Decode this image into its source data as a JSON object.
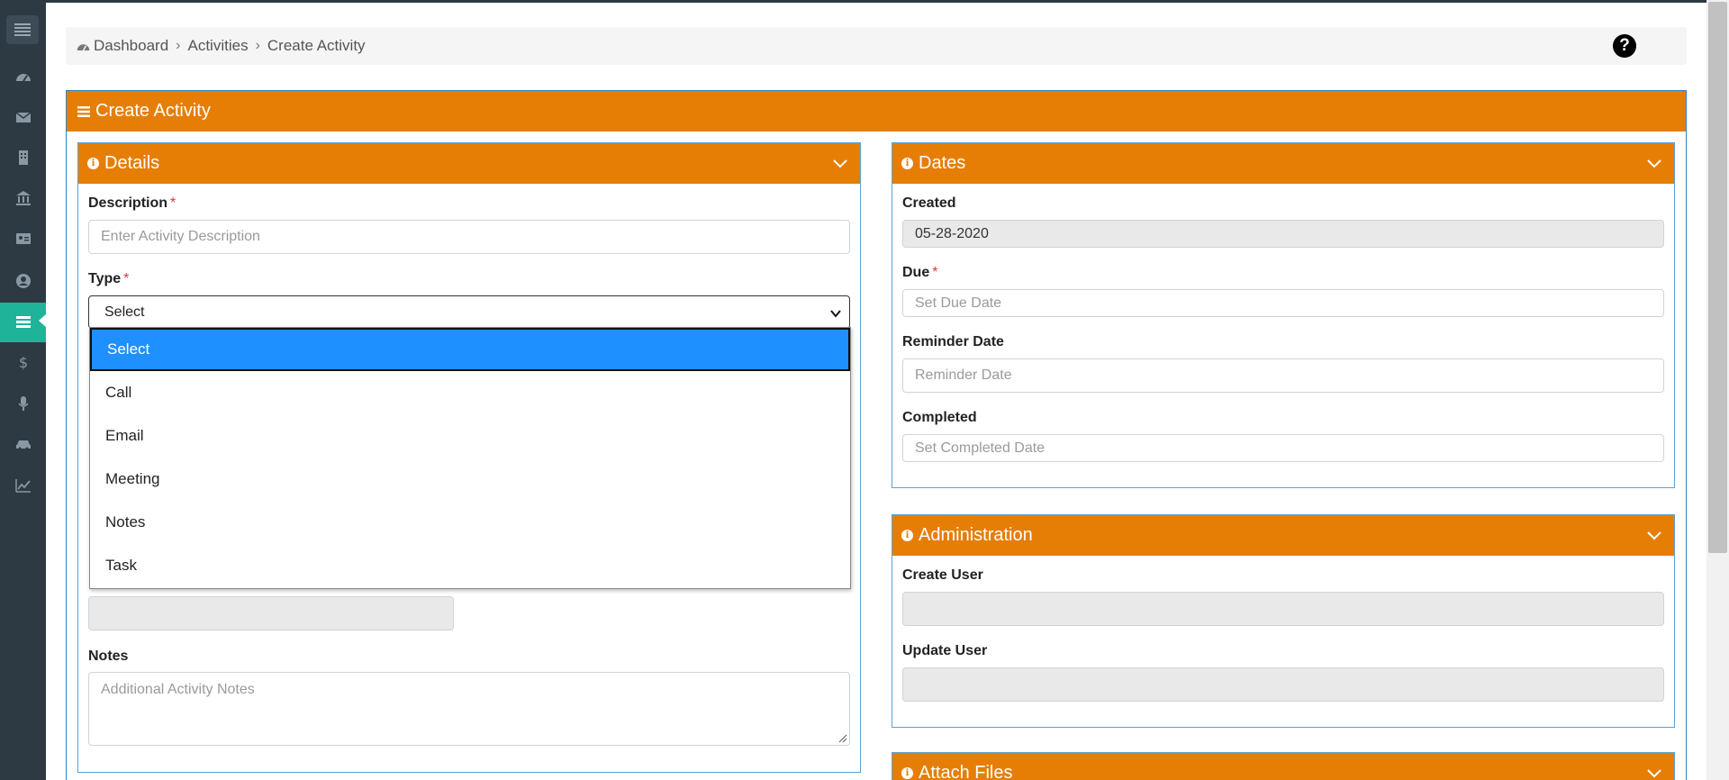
{
  "breadcrumb": {
    "items": [
      "Dashboard",
      "Activities",
      "Create Activity"
    ]
  },
  "main": {
    "title": "Create Activity"
  },
  "details": {
    "title": "Details",
    "description_label": "Description",
    "description_placeholder": "Enter Activity Description",
    "type_label": "Type",
    "type_value": "Select",
    "type_options": [
      "Select",
      "Call",
      "Email",
      "Meeting",
      "Notes",
      "Task"
    ],
    "notes_label": "Notes",
    "notes_placeholder": "Additional Activity Notes"
  },
  "dates": {
    "title": "Dates",
    "created_label": "Created",
    "created_value": "05-28-2020",
    "due_label": "Due",
    "due_placeholder": "Set Due Date",
    "reminder_label": "Reminder Date",
    "reminder_placeholder": "Reminder Date",
    "completed_label": "Completed",
    "completed_placeholder": "Set Completed Date"
  },
  "administration": {
    "title": "Administration",
    "create_user_label": "Create User",
    "create_user_value": "",
    "update_user_label": "Update User",
    "update_user_value": ""
  },
  "attach": {
    "title": "Attach Files"
  },
  "sidebar": {
    "icons": [
      "menu-icon",
      "dashboard-icon",
      "envelope-icon",
      "building-icon",
      "bank-icon",
      "id-card-icon",
      "user-circle-icon",
      "activities-icon",
      "dollar-icon",
      "microphone-icon",
      "car-icon",
      "chart-line-icon"
    ],
    "active": "activities-icon"
  },
  "colors": {
    "header_orange": "#e67e06",
    "sidebar_bg": "#2d3a44",
    "sidebar_active": "#1fb39a",
    "option_highlight": "#1e90ff",
    "panel_border": "#5aa2d0"
  }
}
